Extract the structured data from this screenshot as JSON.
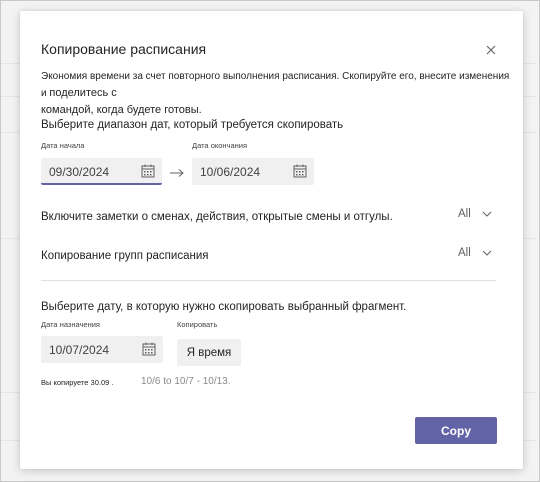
{
  "dialog": {
    "title": "Копирование расписания",
    "description_main": "Экономия времени за счет повторного выполнения расписания. Скопируйте его, внесите изменения и",
    "description_tail": "поделитесь с",
    "description_line2": "командой, когда будете готовы."
  },
  "date_range": {
    "heading": "Выберите диапазон дат, который требуется скопировать",
    "start_label": "Дата начала",
    "start_value": "09/30/2024",
    "end_label": "Дата окончания",
    "end_value": "10/06/2024"
  },
  "options": {
    "include_label": "Включите заметки о сменах, действия, открытые смены и отгулы.",
    "include_value": "All",
    "groups_label": "Копирование групп расписания",
    "groups_value": "All"
  },
  "target": {
    "heading": "Выберите дату, в которую нужно скопировать выбранный фрагмент.",
    "date_label": "Дата назначения",
    "date_value": "10/07/2024",
    "copy_label": "Копировать",
    "copy_value": "Я время",
    "note_prefix": "Вы копируете 30.09 .",
    "note_range": "10/6 to 10/7 - 10/13."
  },
  "footer": {
    "copy_button": "Copy"
  },
  "colors": {
    "accent": "#6264a7",
    "field_bg": "#f0f0f0"
  },
  "icons": [
    "close-icon",
    "calendar-icon",
    "arrow-right-icon",
    "chevron-down-icon"
  ]
}
